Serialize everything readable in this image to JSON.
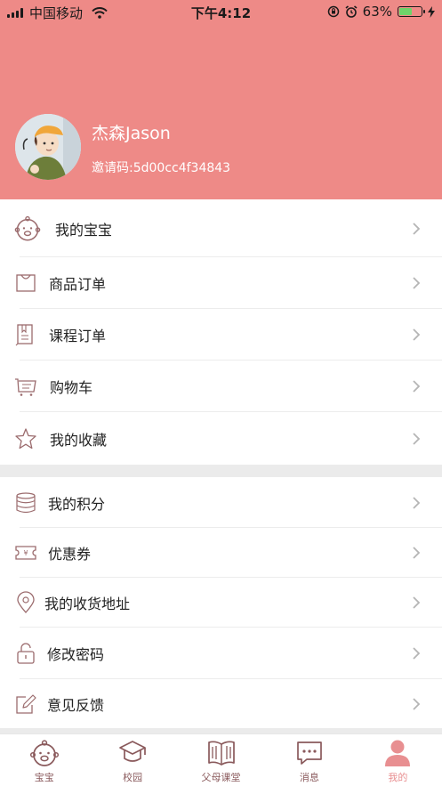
{
  "status_bar": {
    "carrier": "中国移动",
    "time": "下午4:12",
    "battery_percent": "63%",
    "battery_level": 0.63
  },
  "profile": {
    "username": "杰森Jason",
    "invite_code": "邀请码:5d00cc4f34843"
  },
  "colors": {
    "header_bg": "#ee8a87",
    "accent": "#e88f91",
    "icon": "#9b6b6d"
  },
  "menu_group_1": [
    {
      "label": "我的宝宝",
      "icon": "baby-face-icon"
    },
    {
      "label": "商品订单",
      "icon": "shopping-bag-icon"
    },
    {
      "label": "课程订单",
      "icon": "book-icon"
    },
    {
      "label": "购物车",
      "icon": "cart-icon"
    },
    {
      "label": "我的收藏",
      "icon": "star-icon"
    }
  ],
  "menu_group_2": [
    {
      "label": "我的积分",
      "icon": "coins-icon"
    },
    {
      "label": "优惠券",
      "icon": "coupon-icon"
    },
    {
      "label": "我的收货地址",
      "icon": "location-pin-icon"
    },
    {
      "label": "修改密码",
      "icon": "lock-icon"
    },
    {
      "label": "意见反馈",
      "icon": "edit-icon"
    }
  ],
  "tabbar": [
    {
      "label": "宝宝",
      "icon": "baby-face-icon",
      "active": false
    },
    {
      "label": "校园",
      "icon": "graduation-cap-icon",
      "active": false
    },
    {
      "label": "父母课堂",
      "icon": "open-book-icon",
      "active": false
    },
    {
      "label": "消息",
      "icon": "message-icon",
      "active": false
    },
    {
      "label": "我的",
      "icon": "person-icon",
      "active": true
    }
  ]
}
